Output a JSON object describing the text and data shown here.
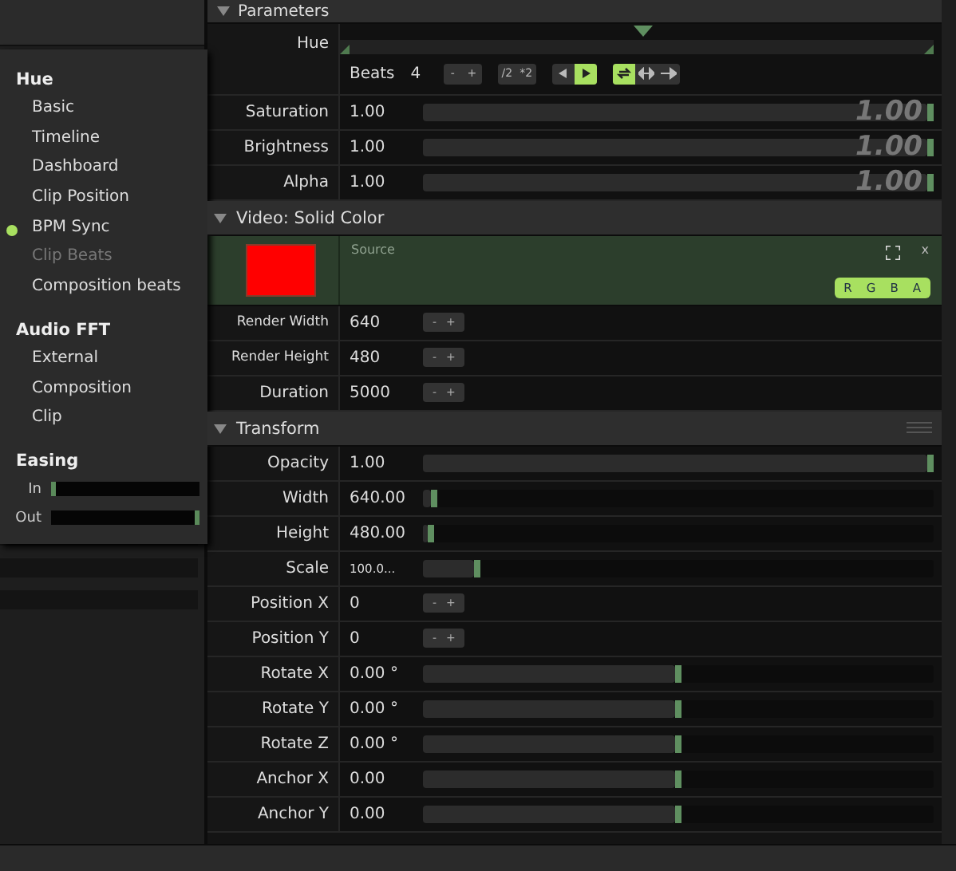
{
  "menu": {
    "sections": [
      {
        "title": "Hue",
        "items": [
          {
            "label": "Basic",
            "selected": false,
            "disabled": false
          },
          {
            "label": "Timeline",
            "selected": false,
            "disabled": false
          },
          {
            "label": "Dashboard",
            "selected": false,
            "disabled": false
          },
          {
            "label": "Clip Position",
            "selected": false,
            "disabled": false
          },
          {
            "label": "BPM Sync",
            "selected": true,
            "disabled": false
          },
          {
            "label": "Clip Beats",
            "selected": false,
            "disabled": true
          },
          {
            "label": "Composition beats",
            "selected": false,
            "disabled": false
          }
        ]
      },
      {
        "title": "Audio FFT",
        "items": [
          {
            "label": "External",
            "selected": false,
            "disabled": false
          },
          {
            "label": "Composition",
            "selected": false,
            "disabled": false
          },
          {
            "label": "Clip",
            "selected": false,
            "disabled": false
          }
        ]
      },
      {
        "title": "Easing",
        "easing": [
          {
            "label": "In",
            "level": 0
          },
          {
            "label": "Out",
            "level": 1
          }
        ]
      }
    ]
  },
  "panel": {
    "title": "Parameters",
    "sections": [
      {
        "rows": [
          {
            "kind": "timeline",
            "label": "Hue",
            "level": 0.51,
            "beats_label": "Beats",
            "beats": "4",
            "steppers": [
              "-",
              "+"
            ],
            "scale": [
              "/2",
              "*2"
            ],
            "direction": [
              {
                "kind": "back",
                "selected": false
              },
              {
                "kind": "forward",
                "selected": true
              }
            ],
            "modes": [
              {
                "kind": "loop",
                "selected": true
              },
              {
                "kind": "bounce",
                "selected": false
              },
              {
                "kind": "once",
                "selected": false
              }
            ]
          },
          {
            "kind": "slider",
            "label": "Saturation",
            "value": "1.00",
            "level": 1,
            "overlay": "1.00"
          },
          {
            "kind": "slider",
            "label": "Brightness",
            "value": "1.00",
            "level": 1,
            "overlay": "1.00"
          },
          {
            "kind": "slider",
            "label": "Alpha",
            "value": "1.00",
            "level": 1,
            "overlay": "1.00"
          }
        ]
      },
      {
        "title": "Video: Solid Color",
        "rows": [
          {
            "kind": "color",
            "color": "#ff0000",
            "source": "Source",
            "close": "x",
            "channels": [
              "R",
              "G",
              "B",
              "A"
            ]
          },
          {
            "kind": "stepper",
            "label": "Render Width",
            "value": "640",
            "steppers": [
              "-",
              "+"
            ]
          },
          {
            "kind": "stepper",
            "label": "Render Height",
            "value": "480",
            "steppers": [
              "-",
              "+"
            ]
          },
          {
            "kind": "stepper",
            "label": "Duration",
            "value": "5000",
            "steppers": [
              "-",
              "+"
            ]
          }
        ]
      },
      {
        "title": "Transform",
        "rows": [
          {
            "kind": "slider",
            "label": "Opacity",
            "value": "1.00",
            "level": 1
          },
          {
            "kind": "slider",
            "label": "Width",
            "value": "640.00",
            "level": 0.015
          },
          {
            "kind": "slider",
            "label": "Height",
            "value": "480.00",
            "level": 0.01
          },
          {
            "kind": "slider",
            "label": "Scale",
            "value": "100.0...",
            "level": 0.1
          },
          {
            "kind": "stepper",
            "label": "Position X",
            "value": "0",
            "steppers": [
              "-",
              "+"
            ]
          },
          {
            "kind": "stepper",
            "label": "Position Y",
            "value": "0",
            "steppers": [
              "-",
              "+"
            ]
          },
          {
            "kind": "slider",
            "label": "Rotate X",
            "value": "0.00 °",
            "level": 0.5
          },
          {
            "kind": "slider",
            "label": "Rotate Y",
            "value": "0.00 °",
            "level": 0.5
          },
          {
            "kind": "slider",
            "label": "Rotate Z",
            "value": "0.00 °",
            "level": 0.5
          },
          {
            "kind": "slider",
            "label": "Anchor X",
            "value": "0.00",
            "level": 0.5
          },
          {
            "kind": "slider",
            "label": "Anchor Y",
            "value": "0.00",
            "level": 0.5
          }
        ]
      }
    ]
  }
}
